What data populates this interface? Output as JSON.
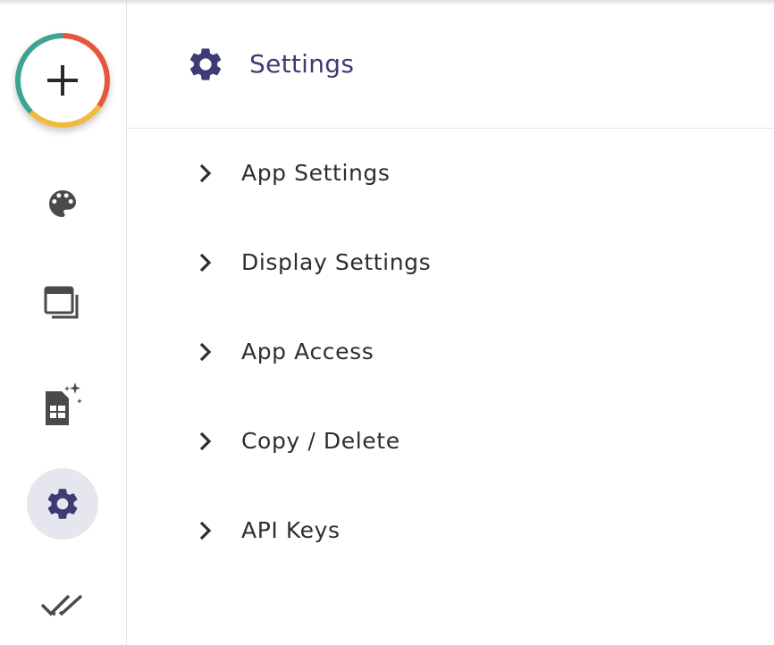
{
  "rail": {
    "create_icon": "plus-icon",
    "items": [
      {
        "name": "theme",
        "icon": "palette-icon",
        "active": false
      },
      {
        "name": "views",
        "icon": "layers-icon",
        "active": false
      },
      {
        "name": "data",
        "icon": "sheet-sparkle-icon",
        "active": false
      },
      {
        "name": "settings",
        "icon": "gear-icon",
        "active": true
      },
      {
        "name": "checks",
        "icon": "double-check-icon",
        "active": false
      }
    ]
  },
  "header": {
    "title": "Settings",
    "icon": "gear-icon"
  },
  "menu": {
    "items": [
      {
        "label": "App Settings"
      },
      {
        "label": "Display Settings"
      },
      {
        "label": "App Access"
      },
      {
        "label": "Copy / Delete"
      },
      {
        "label": "API Keys"
      }
    ]
  },
  "colors": {
    "accent": "#3e3c74",
    "icon_gray": "#4a4a4a",
    "active_bg": "#e6e6ee",
    "ring_red": "#e4573d",
    "ring_yellow": "#f0b93f",
    "ring_teal": "#3ea392"
  }
}
